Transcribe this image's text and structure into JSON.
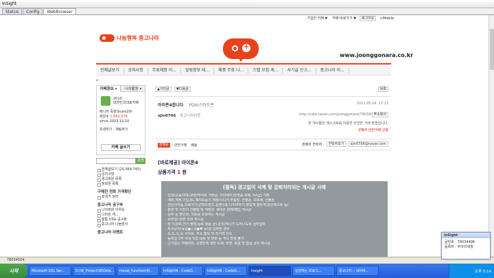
{
  "window": {
    "title": "InSight"
  },
  "tabs": [
    {
      "label": "Status"
    },
    {
      "label": "Config"
    },
    {
      "label": "WebBrowser"
    }
  ],
  "topnav": {
    "links": [
      "가입한 카페 ▼",
      "카페 바로가기 ▼",
      "로그아웃",
      "+Mobile"
    ]
  },
  "site": {
    "logo_text": "나눔행복 중고나라",
    "url": "www.joonggonara.co.kr",
    "colors": {
      "accent": "#e8421d",
      "green": "#6ab04c",
      "warnbox": "#929a9e"
    }
  },
  "menu": [
    "전체글보기",
    "공지사항",
    "무료체험 이...",
    "앞뒷정보 테...",
    "체중 무료 나...",
    "스텝 모집 게...",
    "사기글 신고...",
    "중고나라 이..."
  ],
  "sidebar": {
    "tabs": [
      "카페정보 ▾",
      "나의활동 ▾"
    ],
    "cafe_year": "2010",
    "cafe_label": "대한민국대표카페",
    "manager": "매니저 죽장(bussi29)",
    "members_label": "회원수",
    "members_value": "1,662,578",
    "since": "since 2003.12.10",
    "invite": "초대하기",
    "chat": "채팅하기",
    "write_button": "카페 글쓰기",
    "search_button": "검색",
    "counter": "전체글보기 (25,364,745)",
    "list": [
      "공지사항",
      "경고회원 목록",
      "정회원 목록"
    ],
    "group_head": "구매전 전화 가격확인",
    "group_item": "회색가 정리",
    "group2_head": "중고나라 공구부",
    "group2_items": [
      "나의회원 이하도",
      "나라원 게...",
      "울통 USG 공구화",
      "중고나라 나눔방사"
    ],
    "bottom_head": "중고나라 이벤트"
  },
  "main": {
    "prev_button": "▲이전글",
    "next_button": "▼다음글",
    "list_button": "목록",
    "post_title": "아이폰4팝니다",
    "category": "PDA/스마트폰",
    "date": "2011.05.24. 17:13",
    "author": "sjin0706",
    "grade": "중고나라이웃",
    "post_url": "http://cafe.naver.com/joonggonara/78034402",
    "copy_button": "주소복사",
    "notice1": "본 게시물은 에스크로를 이용한 안전한 거래 방법입니다.",
    "notice2": "구매자 안전거래 신청",
    "status_tag": "판매중",
    "safe_trade": "안전거래",
    "delivery": "배송",
    "contact_label": "판매자 연락처 :",
    "contact_button": "연락처보기",
    "contact_email": "sjin0706@naver.com",
    "product_prefix": "[바로제공]",
    "product_name": "아이폰4",
    "price_label": "상품가격",
    "price_value": "1",
    "price_unit": "원",
    "warn_title": "[필독] 경고없이 삭제 및 강퇴처리되는 게시글 사례",
    "warn_items": [
      "- 업자/공동/대포/교환/무서류 거래글, 이미테이션(명품 복제, SA급) 거래",
      "- 계좌,계정,가입,RL,해지보증기,계정/시디키,무통장, 헌혈증, 보호세, 선불폰",
      "- 전문의약품,의료기기(콘택트렌즈,실렌더포,다이어트기,혈압계,혈당계,임신테스트 등)",
      "- 분양 및 사전의 선불형 및 계정권, 휴대폰 판매/매입 게시글",
      "- 중부 중 할인권, 비트를 조회하는 게시글",
      "- 모바일/ 관련 조회 게시글",
      "- 닫기(강퇴,전기 불법 등록 활동 글),순위/게시가 드러나도록 글자입력",
      "- 특수문자(★◎●☆※●♥ 등)를 입력한 경우",
      "- 도,도,도,도 사이트, 주소 홍보 및 직거래 유도",
      "- 등록일 2주 이내 직접 내용 및 번호 등 게시 변경 불가",
      "- 근거없는 카페비방, 운영진에 대한 도배, 비방, 욕설 및 잡글 금지 게시글"
    ]
  },
  "status_id": "78034504",
  "taskbar": {
    "start": "시작",
    "tasks": [
      "Microsoft SQL Ser...",
      "D:\\W_Project\\W\\Delp...",
      "mssql_function(정...",
      "InSightN - CodeG...",
      "InSightN - CodeG...",
      "Insight",
      "상담하는 프로그...",
      "중고나라 :: 네이버..."
    ],
    "clock": "오후 5:14"
  },
  "popup": {
    "title": "InSight",
    "line1": "글번호 : 78034496",
    "line2": "등록자 : 주야의세월"
  }
}
